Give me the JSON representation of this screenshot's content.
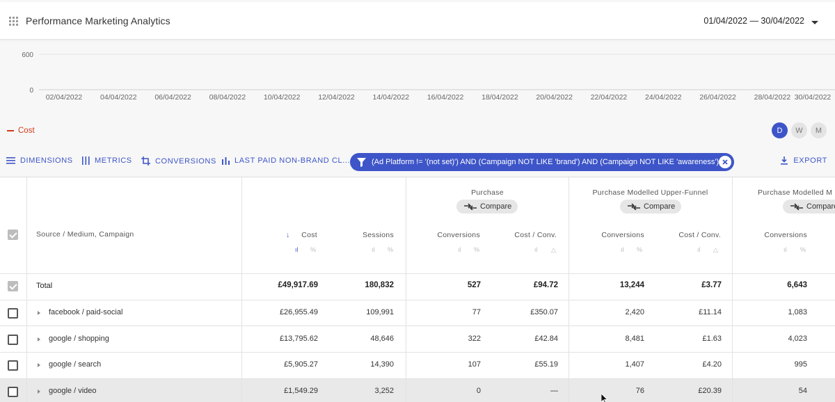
{
  "header": {
    "title": "Performance Marketing Analytics",
    "date_range": "01/04/2022 — 30/04/2022",
    "icon": "apps-grid-icon"
  },
  "chart_data": {
    "type": "line",
    "y_ticks": [
      "600",
      "0"
    ],
    "x": [
      "02/04/2022",
      "04/04/2022",
      "06/04/2022",
      "08/04/2022",
      "10/04/2022",
      "12/04/2022",
      "14/04/2022",
      "16/04/2022",
      "18/04/2022",
      "20/04/2022",
      "22/04/2022",
      "24/04/2022",
      "26/04/2022",
      "28/04/2022",
      "30/04/2022"
    ],
    "ylim": [
      0,
      600
    ],
    "series": [
      {
        "name": "Cost",
        "color": "#d13a1b",
        "values": []
      }
    ],
    "grid": true,
    "legend_position": "bottom-left"
  },
  "granularity": {
    "options": [
      "D",
      "W",
      "M"
    ],
    "selected": "D"
  },
  "toolbar": {
    "dimensions": "DIMENSIONS",
    "metrics": "METRICS",
    "conversions": "CONVERSIONS",
    "attribution": "LAST PAID NON-BRAND CL...",
    "filter": "(Ad Platform != '(not set)') AND (Campaign NOT LIKE 'brand') AND (Campaign NOT LIKE 'awareness')",
    "export": "EXPORT"
  },
  "table": {
    "dimension_header": "Source / Medium, Campaign",
    "groups": [
      {
        "label": "Purchase",
        "compare": "Compare"
      },
      {
        "label": "Purchase Modelled Upper-Funnel",
        "compare": "Compare"
      },
      {
        "label": "Purchase Modelled M",
        "compare": "Compare"
      }
    ],
    "columns": [
      "Cost",
      "Sessions",
      "Conversions",
      "Cost / Conv.",
      "Conversions",
      "Cost / Conv.",
      "Conversions"
    ],
    "sort_indicator": "↓",
    "total": {
      "label": "Total",
      "values": [
        "£49,917.69",
        "180,832",
        "527",
        "£94.72",
        "13,244",
        "£3.77",
        "6,643"
      ]
    },
    "rows": [
      {
        "label": "facebook / paid-social",
        "values": [
          "£26,955.49",
          "109,991",
          "77",
          "£350.07",
          "2,420",
          "£11.14",
          "1,083"
        ]
      },
      {
        "label": "google / shopping",
        "values": [
          "£13,795.62",
          "48,646",
          "322",
          "£42.84",
          "8,481",
          "£1.63",
          "4,023"
        ]
      },
      {
        "label": "google / search",
        "values": [
          "£5,905.27",
          "14,390",
          "107",
          "£55.19",
          "1,407",
          "£4.20",
          "995"
        ]
      },
      {
        "label": "google / video",
        "values": [
          "£1,549.29",
          "3,252",
          "0",
          "—",
          "76",
          "£20.39",
          "54"
        ]
      }
    ]
  },
  "colors": {
    "accent": "#3d55c8",
    "cost_series": "#d13a1b"
  }
}
